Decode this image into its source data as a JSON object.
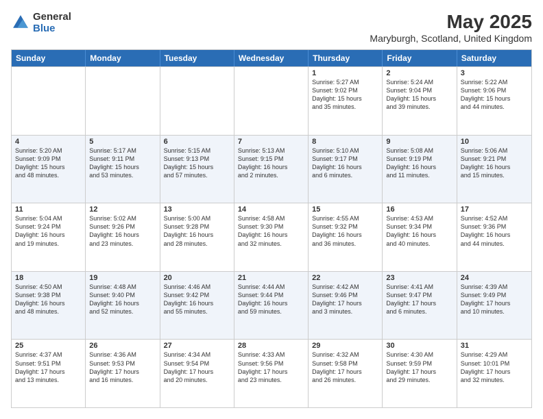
{
  "header": {
    "title": "May 2025",
    "subtitle": "Maryburgh, Scotland, United Kingdom",
    "logo_general": "General",
    "logo_blue": "Blue"
  },
  "days_of_week": [
    "Sunday",
    "Monday",
    "Tuesday",
    "Wednesday",
    "Thursday",
    "Friday",
    "Saturday"
  ],
  "rows": [
    [
      {
        "day": "",
        "info": ""
      },
      {
        "day": "",
        "info": ""
      },
      {
        "day": "",
        "info": ""
      },
      {
        "day": "",
        "info": ""
      },
      {
        "day": "1",
        "info": "Sunrise: 5:27 AM\nSunset: 9:02 PM\nDaylight: 15 hours\nand 35 minutes."
      },
      {
        "day": "2",
        "info": "Sunrise: 5:24 AM\nSunset: 9:04 PM\nDaylight: 15 hours\nand 39 minutes."
      },
      {
        "day": "3",
        "info": "Sunrise: 5:22 AM\nSunset: 9:06 PM\nDaylight: 15 hours\nand 44 minutes."
      }
    ],
    [
      {
        "day": "4",
        "info": "Sunrise: 5:20 AM\nSunset: 9:09 PM\nDaylight: 15 hours\nand 48 minutes."
      },
      {
        "day": "5",
        "info": "Sunrise: 5:17 AM\nSunset: 9:11 PM\nDaylight: 15 hours\nand 53 minutes."
      },
      {
        "day": "6",
        "info": "Sunrise: 5:15 AM\nSunset: 9:13 PM\nDaylight: 15 hours\nand 57 minutes."
      },
      {
        "day": "7",
        "info": "Sunrise: 5:13 AM\nSunset: 9:15 PM\nDaylight: 16 hours\nand 2 minutes."
      },
      {
        "day": "8",
        "info": "Sunrise: 5:10 AM\nSunset: 9:17 PM\nDaylight: 16 hours\nand 6 minutes."
      },
      {
        "day": "9",
        "info": "Sunrise: 5:08 AM\nSunset: 9:19 PM\nDaylight: 16 hours\nand 11 minutes."
      },
      {
        "day": "10",
        "info": "Sunrise: 5:06 AM\nSunset: 9:21 PM\nDaylight: 16 hours\nand 15 minutes."
      }
    ],
    [
      {
        "day": "11",
        "info": "Sunrise: 5:04 AM\nSunset: 9:24 PM\nDaylight: 16 hours\nand 19 minutes."
      },
      {
        "day": "12",
        "info": "Sunrise: 5:02 AM\nSunset: 9:26 PM\nDaylight: 16 hours\nand 23 minutes."
      },
      {
        "day": "13",
        "info": "Sunrise: 5:00 AM\nSunset: 9:28 PM\nDaylight: 16 hours\nand 28 minutes."
      },
      {
        "day": "14",
        "info": "Sunrise: 4:58 AM\nSunset: 9:30 PM\nDaylight: 16 hours\nand 32 minutes."
      },
      {
        "day": "15",
        "info": "Sunrise: 4:55 AM\nSunset: 9:32 PM\nDaylight: 16 hours\nand 36 minutes."
      },
      {
        "day": "16",
        "info": "Sunrise: 4:53 AM\nSunset: 9:34 PM\nDaylight: 16 hours\nand 40 minutes."
      },
      {
        "day": "17",
        "info": "Sunrise: 4:52 AM\nSunset: 9:36 PM\nDaylight: 16 hours\nand 44 minutes."
      }
    ],
    [
      {
        "day": "18",
        "info": "Sunrise: 4:50 AM\nSunset: 9:38 PM\nDaylight: 16 hours\nand 48 minutes."
      },
      {
        "day": "19",
        "info": "Sunrise: 4:48 AM\nSunset: 9:40 PM\nDaylight: 16 hours\nand 52 minutes."
      },
      {
        "day": "20",
        "info": "Sunrise: 4:46 AM\nSunset: 9:42 PM\nDaylight: 16 hours\nand 55 minutes."
      },
      {
        "day": "21",
        "info": "Sunrise: 4:44 AM\nSunset: 9:44 PM\nDaylight: 16 hours\nand 59 minutes."
      },
      {
        "day": "22",
        "info": "Sunrise: 4:42 AM\nSunset: 9:46 PM\nDaylight: 17 hours\nand 3 minutes."
      },
      {
        "day": "23",
        "info": "Sunrise: 4:41 AM\nSunset: 9:47 PM\nDaylight: 17 hours\nand 6 minutes."
      },
      {
        "day": "24",
        "info": "Sunrise: 4:39 AM\nSunset: 9:49 PM\nDaylight: 17 hours\nand 10 minutes."
      }
    ],
    [
      {
        "day": "25",
        "info": "Sunrise: 4:37 AM\nSunset: 9:51 PM\nDaylight: 17 hours\nand 13 minutes."
      },
      {
        "day": "26",
        "info": "Sunrise: 4:36 AM\nSunset: 9:53 PM\nDaylight: 17 hours\nand 16 minutes."
      },
      {
        "day": "27",
        "info": "Sunrise: 4:34 AM\nSunset: 9:54 PM\nDaylight: 17 hours\nand 20 minutes."
      },
      {
        "day": "28",
        "info": "Sunrise: 4:33 AM\nSunset: 9:56 PM\nDaylight: 17 hours\nand 23 minutes."
      },
      {
        "day": "29",
        "info": "Sunrise: 4:32 AM\nSunset: 9:58 PM\nDaylight: 17 hours\nand 26 minutes."
      },
      {
        "day": "30",
        "info": "Sunrise: 4:30 AM\nSunset: 9:59 PM\nDaylight: 17 hours\nand 29 minutes."
      },
      {
        "day": "31",
        "info": "Sunrise: 4:29 AM\nSunset: 10:01 PM\nDaylight: 17 hours\nand 32 minutes."
      }
    ]
  ]
}
